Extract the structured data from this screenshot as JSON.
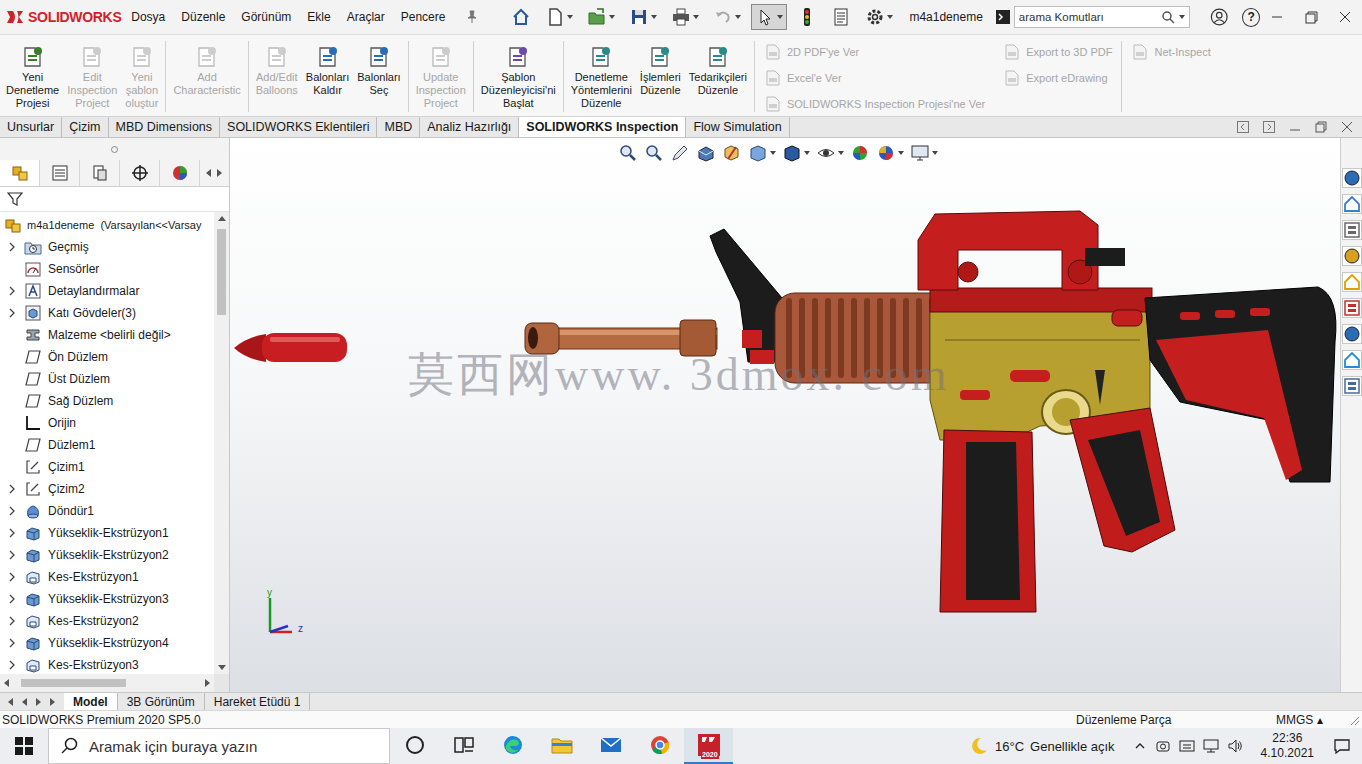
{
  "app": {
    "logo": "SOLIDWORKS"
  },
  "menu": [
    "Dosya",
    "Düzenle",
    "Görünüm",
    "Ekle",
    "Araçlar",
    "Pencere"
  ],
  "quick_access": [
    {
      "kind": "home",
      "dropdown": false,
      "pressed": false,
      "disabled": false
    },
    {
      "kind": "new",
      "dropdown": true,
      "pressed": false,
      "disabled": false
    },
    {
      "kind": "open",
      "dropdown": true,
      "pressed": false,
      "disabled": false
    },
    {
      "kind": "save",
      "dropdown": true,
      "pressed": false,
      "disabled": false
    },
    {
      "kind": "print",
      "dropdown": true,
      "pressed": false,
      "disabled": false
    },
    {
      "kind": "undo",
      "dropdown": true,
      "pressed": false,
      "disabled": true
    },
    {
      "kind": "select",
      "dropdown": true,
      "pressed": true,
      "disabled": false
    },
    {
      "kind": "rebuild",
      "dropdown": false,
      "pressed": false,
      "disabled": false
    },
    {
      "kind": "filelist",
      "dropdown": false,
      "pressed": false,
      "disabled": false
    },
    {
      "kind": "options",
      "dropdown": true,
      "pressed": false,
      "disabled": false
    }
  ],
  "document_title": "m4a1deneme",
  "search": {
    "placeholder": "arama Komutları"
  },
  "help": "?",
  "ribbon_groups": [
    {
      "kind": "large",
      "buttons": [
        {
          "lines": [
            "Yeni",
            "Denetleme",
            "Projesi"
          ],
          "disabled": false
        },
        {
          "lines": [
            "Edit",
            "Inspection",
            "Project"
          ],
          "disabled": true
        },
        {
          "lines": [
            "Yeni",
            "şablon",
            "oluştur"
          ],
          "disabled": true
        }
      ]
    },
    {
      "kind": "large",
      "buttons": [
        {
          "lines": [
            "Add",
            "Characteristic"
          ],
          "disabled": true
        }
      ]
    },
    {
      "kind": "large",
      "buttons": [
        {
          "lines": [
            "Add/Edit",
            "Balloons"
          ],
          "disabled": true
        },
        {
          "lines": [
            "Balonları",
            "Kaldır"
          ],
          "disabled": false
        },
        {
          "lines": [
            "Balonları",
            "Seç"
          ],
          "disabled": false
        }
      ]
    },
    {
      "kind": "large",
      "buttons": [
        {
          "lines": [
            "Update",
            "Inspection",
            "Project"
          ],
          "disabled": true
        }
      ]
    },
    {
      "kind": "large",
      "buttons": [
        {
          "lines": [
            "Şablon",
            "Düzenleyicisi'ni",
            "Başlat"
          ],
          "disabled": false
        }
      ]
    },
    {
      "kind": "large",
      "buttons": [
        {
          "lines": [
            "Denetleme",
            "Yöntemlerini",
            "Düzenle"
          ],
          "disabled": false
        },
        {
          "lines": [
            "İşlemleri",
            "Düzenle"
          ],
          "disabled": false
        },
        {
          "lines": [
            "Tedarikçileri",
            "Düzenle"
          ],
          "disabled": false
        }
      ]
    },
    {
      "kind": "small",
      "columns": [
        [
          {
            "label": "2D PDF'ye Ver",
            "disabled": true
          },
          {
            "label": "Excel'e Ver",
            "disabled": true
          },
          {
            "label": "SOLIDWORKS Inspection Projesi'ne Ver",
            "disabled": true
          }
        ],
        [
          {
            "label": "Export to 3D PDF",
            "disabled": true
          },
          {
            "label": "Export eDrawing",
            "disabled": true
          }
        ]
      ]
    },
    {
      "kind": "small",
      "columns": [
        [
          {
            "label": "Net-Inspect",
            "disabled": true
          }
        ]
      ]
    }
  ],
  "command_tabs": [
    {
      "label": "Unsurlar",
      "selected": false
    },
    {
      "label": "Çizim",
      "selected": false
    },
    {
      "label": "MBD Dimensions",
      "selected": false
    },
    {
      "label": "SOLIDWORKS Eklentileri",
      "selected": false
    },
    {
      "label": "MBD",
      "selected": false
    },
    {
      "label": "Analiz Hazırlığı",
      "selected": false
    },
    {
      "label": "SOLIDWORKS Inspection",
      "selected": true
    },
    {
      "label": "Flow Simulation",
      "selected": false
    }
  ],
  "panel_tabs": [
    {
      "kind": "feature",
      "selected": true
    },
    {
      "kind": "property",
      "selected": false
    },
    {
      "kind": "config",
      "selected": false
    },
    {
      "kind": "dimxpert",
      "selected": false
    },
    {
      "kind": "display",
      "selected": false
    }
  ],
  "feature_tree": {
    "root": "m4a1deneme  (Varsayılan<<Varsay",
    "items": [
      {
        "label": "Geçmiş",
        "kind": "history",
        "expandable": true
      },
      {
        "label": "Sensörler",
        "kind": "sensor",
        "expandable": false
      },
      {
        "label": "Detaylandırmalar",
        "kind": "annotation",
        "expandable": true
      },
      {
        "label": "Katı Gövdeler(3)",
        "kind": "bodies",
        "expandable": true
      },
      {
        "label": "Malzeme <belirli değil>",
        "kind": "material",
        "expandable": false
      },
      {
        "label": "Ön Düzlem",
        "kind": "plane",
        "expandable": false
      },
      {
        "label": "Üst Düzlem",
        "kind": "plane",
        "expandable": false
      },
      {
        "label": "Sağ Düzlem",
        "kind": "plane",
        "expandable": false
      },
      {
        "label": "Orijin",
        "kind": "origin",
        "expandable": false
      },
      {
        "label": "Düzlem1",
        "kind": "plane",
        "expandable": false
      },
      {
        "label": "Çizim1",
        "kind": "sketch",
        "expandable": false
      },
      {
        "label": "Çizim2",
        "kind": "sketch",
        "expandable": true
      },
      {
        "label": "Döndür1",
        "kind": "revolve",
        "expandable": true
      },
      {
        "label": "Yükseklik-Ekstrüzyon1",
        "kind": "extrude",
        "expandable": true
      },
      {
        "label": "Yükseklik-Ekstrüzyon2",
        "kind": "extrude",
        "expandable": true
      },
      {
        "label": "Kes-Ekstrüzyon1",
        "kind": "cut",
        "expandable": true
      },
      {
        "label": "Yükseklik-Ekstrüzyon3",
        "kind": "extrude",
        "expandable": true
      },
      {
        "label": "Kes-Ekstrüzyon2",
        "kind": "cut",
        "expandable": true
      },
      {
        "label": "Yükseklik-Ekstrüzyon4",
        "kind": "extrude",
        "expandable": true
      },
      {
        "label": "Kes-Ekstrüzyon3",
        "kind": "cut",
        "expandable": true
      }
    ]
  },
  "viewport": {
    "watermark": "莫西网www. 3dmox. com",
    "axes": [
      {
        "label": "y",
        "color": "#1a9a1a"
      },
      {
        "label": "z",
        "color": "#2233cc"
      }
    ]
  },
  "bottom_tabs": [
    {
      "label": "Model",
      "selected": true
    },
    {
      "label": "3B Görünüm",
      "selected": false
    },
    {
      "label": "Hareket Etüdü 1",
      "selected": false
    }
  ],
  "status_bar": {
    "product": "SOLIDWORKS Premium 2020 SP5.0",
    "mode": "Düzenleme Parça",
    "units": "MMGS",
    "units_arrow": "▴"
  },
  "taskbar": {
    "search_placeholder": "Aramak için buraya yazın",
    "apps": [
      {
        "kind": "cortana",
        "active": false
      },
      {
        "kind": "taskview",
        "active": false
      },
      {
        "kind": "edge",
        "active": false
      },
      {
        "kind": "explorer",
        "active": false
      },
      {
        "kind": "mail",
        "active": false
      },
      {
        "kind": "chrome",
        "active": false
      },
      {
        "kind": "solidworks",
        "active": true,
        "badge": "2020"
      }
    ],
    "temperature": "16°C",
    "weather": "Genellikle açık",
    "time": "22:36",
    "date": "4.10.2021"
  }
}
